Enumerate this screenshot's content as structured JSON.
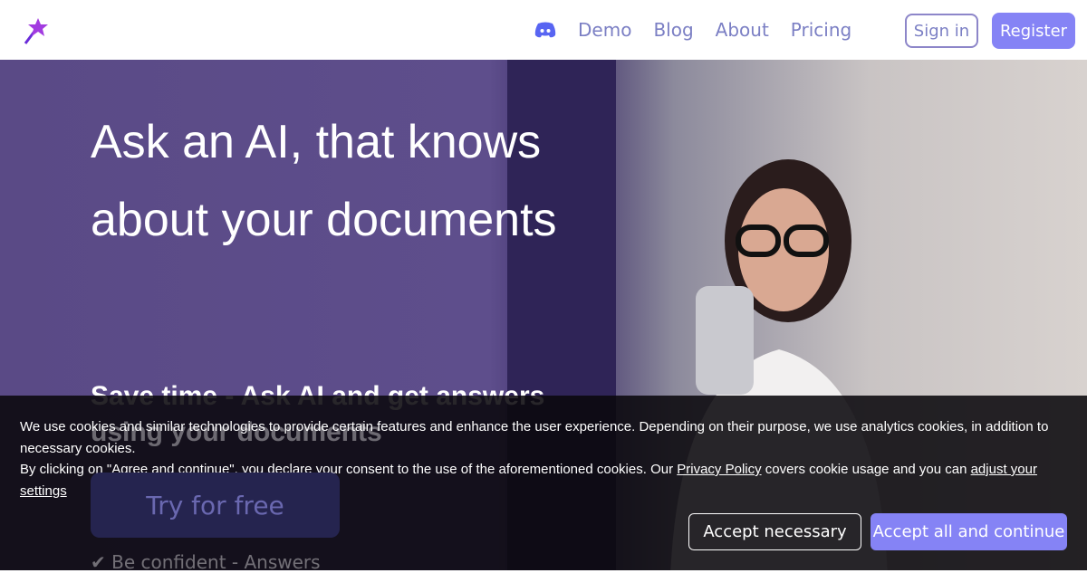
{
  "nav": {
    "links": [
      "Demo",
      "Blog",
      "About",
      "Pricing"
    ],
    "signin": "Sign in",
    "register": "Register"
  },
  "hero": {
    "title": "Ask an AI, that knows about your documents",
    "subtitle_line1": "Save time - Ask AI and get answers",
    "subtitle_line2": "using your documents",
    "cta": "Try for free",
    "confident": "Be confident - Answers"
  },
  "cookie": {
    "text1": "We use cookies and similar technologies to provide certain features and enhance the user experience. Depending on their purpose, we use analytics cookies, in addition to necessary cookies.",
    "text2": "By clicking on \"Agree and continue\", you declare your consent to the use of the aforementioned cookies. Our ",
    "privacy": "Privacy Policy",
    "text3": " covers cookie usage and you can ",
    "adjust": "adjust your settings",
    "accept_necessary": "Accept necessary",
    "accept_all": "Accept all and continue"
  },
  "colors": {
    "accent": "#8583f5",
    "link": "#7b7fc4",
    "discord": "#5865f2"
  }
}
